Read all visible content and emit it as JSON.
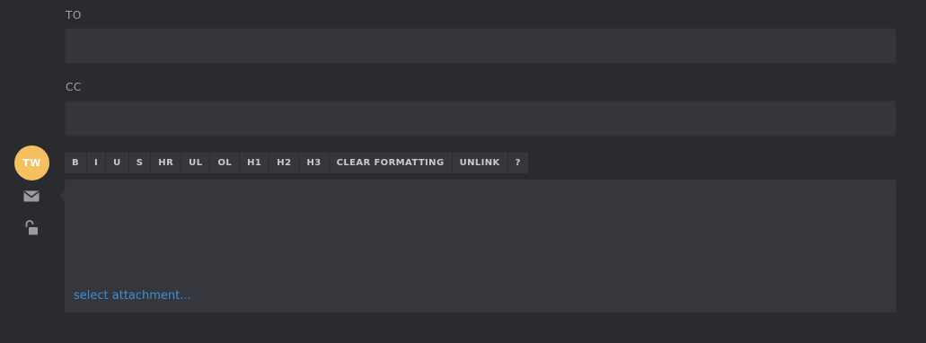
{
  "to": {
    "label": "TO",
    "value": ""
  },
  "cc": {
    "label": "CC",
    "value": ""
  },
  "sender": {
    "initials": "TW",
    "avatar_color": "#f6c060"
  },
  "rail_icons": [
    "envelope-icon",
    "unlock-icon"
  ],
  "toolbar": {
    "bold": "B",
    "italic": "I",
    "underline": "U",
    "strike": "S",
    "hr": "HR",
    "ul": "UL",
    "ol": "OL",
    "h1": "H1",
    "h2": "H2",
    "h3": "H3",
    "clear_formatting": "CLEAR FORMATTING",
    "unlink": "UNLINK",
    "help": "?"
  },
  "editor": {
    "attachment_link": "select attachment..."
  },
  "colors": {
    "background": "#2a2b2e",
    "field": "#35363b",
    "link": "#3d8fd6",
    "label": "#9fa1a6"
  }
}
